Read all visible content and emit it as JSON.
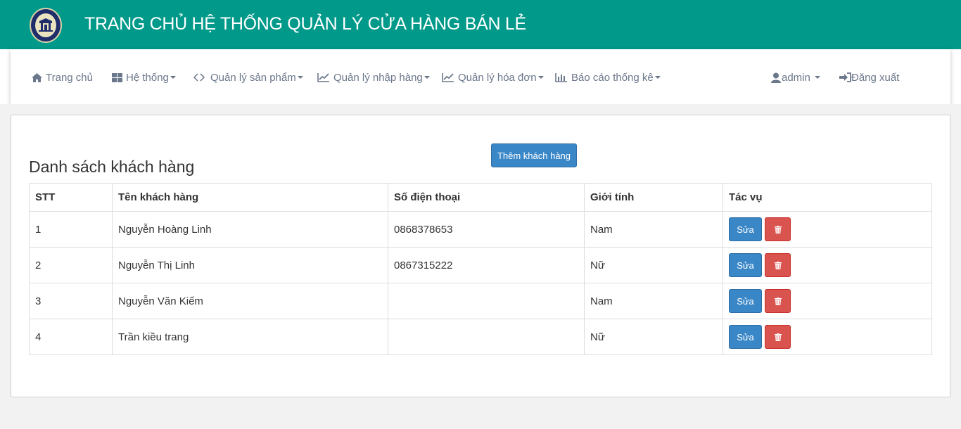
{
  "header": {
    "title": "TRANG CHỦ HỆ THỐNG QUẢN LÝ CỬA HÀNG BÁN LẺ",
    "logo_icon": "university-seal-icon"
  },
  "nav": {
    "items": [
      {
        "label": "Trang chủ",
        "icon": "home-icon"
      },
      {
        "label": "Hệ thống",
        "icon": "grid-icon"
      },
      {
        "label": "Quản lý sản phẩm",
        "icon": "code-icon"
      },
      {
        "label": "Quản lý nhập hàng",
        "icon": "chart-line-icon"
      },
      {
        "label": "Quản lý hóa đơn",
        "icon": "chart-line-icon"
      },
      {
        "label": "Báo cáo thống kê",
        "icon": "bar-chart-icon"
      }
    ],
    "user": {
      "label": "admin",
      "icon": "user-icon"
    },
    "logout": {
      "label": "Đăng xuất",
      "icon": "logout-icon"
    }
  },
  "main": {
    "title": "Danh sách khách hàng",
    "add_button": "Thêm khách hàng",
    "table": {
      "headers": [
        "STT",
        "Tên khách hàng",
        "Số điện thoại",
        "Giới tính",
        "Tác vụ"
      ],
      "rows": [
        {
          "stt": "1",
          "name": "Nguyễn Hoàng Linh",
          "phone": "0868378653",
          "gender": "Nam"
        },
        {
          "stt": "2",
          "name": "Nguyễn Thị Linh",
          "phone": "0867315222",
          "gender": "Nữ"
        },
        {
          "stt": "3",
          "name": "Nguyễn Văn Kiếm",
          "phone": "",
          "gender": "Nam"
        },
        {
          "stt": "4",
          "name": "Trần kiều trang",
          "phone": "",
          "gender": "Nữ"
        }
      ],
      "edit_label": "Sửa",
      "delete_icon": "trash-icon"
    }
  },
  "colors": {
    "header_bg": "#00998a",
    "primary": "#3a87c8",
    "danger": "#d9534f"
  }
}
